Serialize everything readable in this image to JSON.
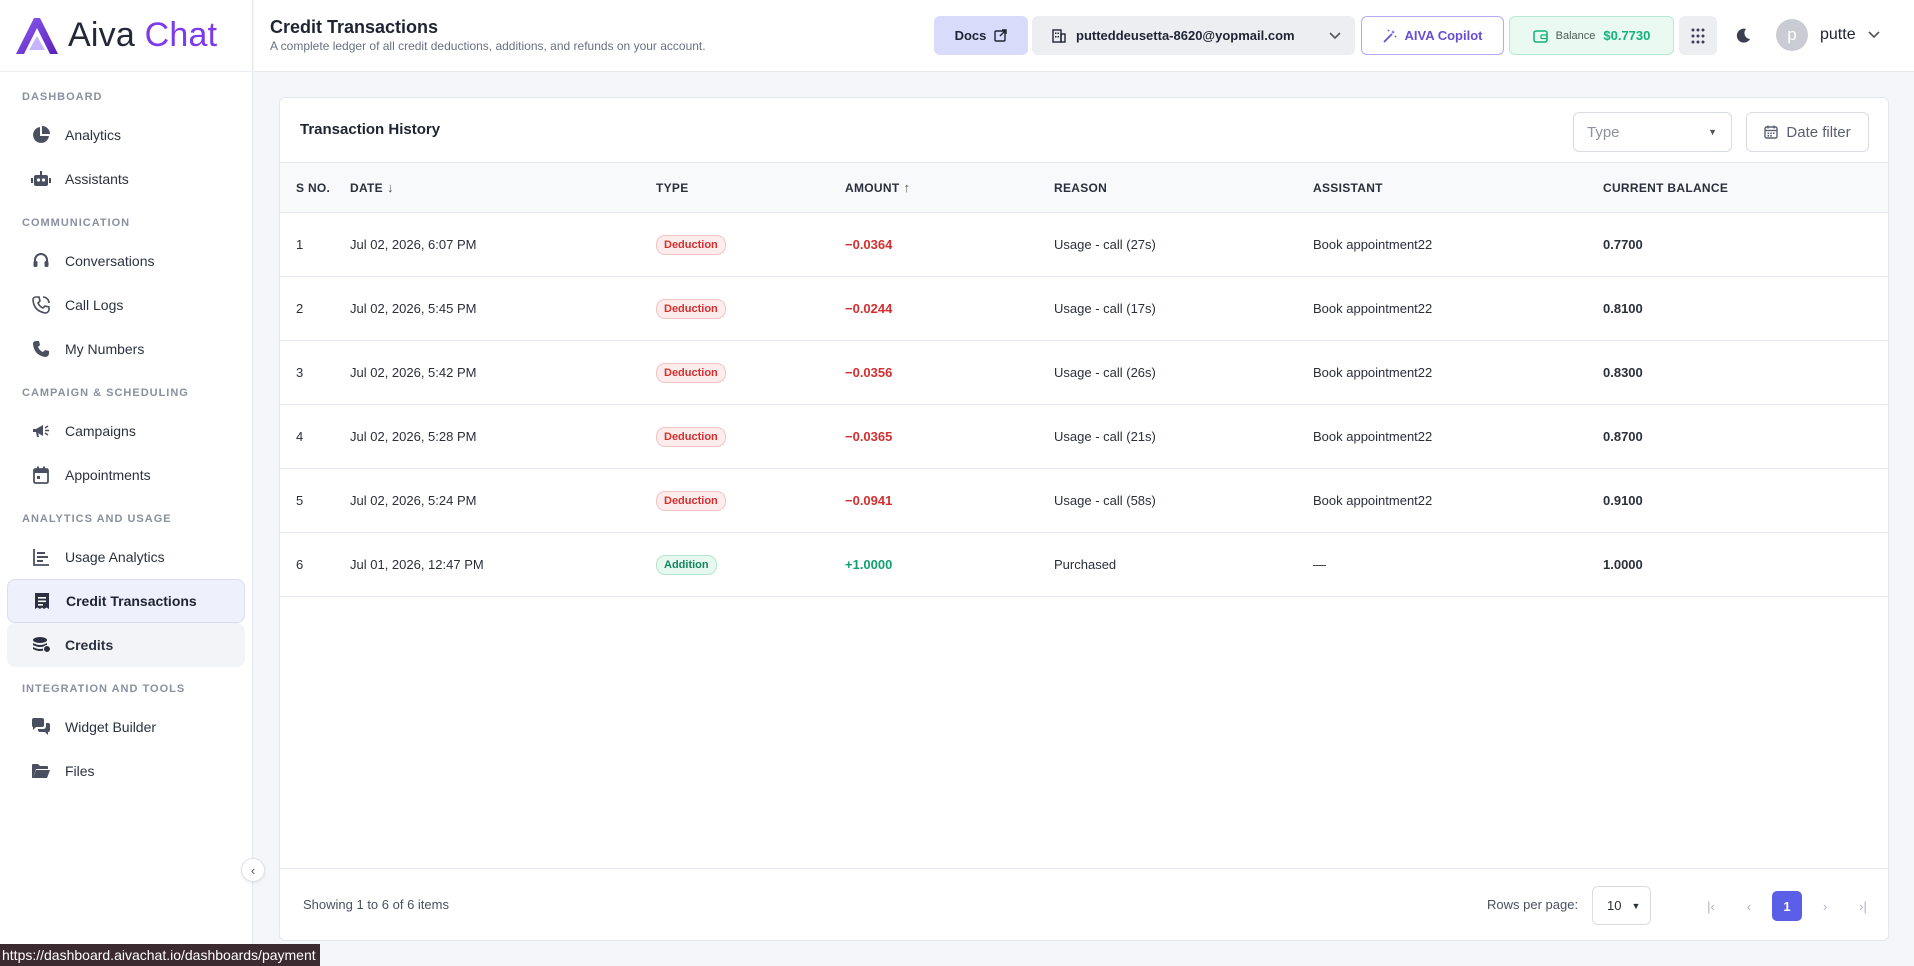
{
  "app": {
    "name_a": "Aiva",
    "name_b": " Chat",
    "brand_color": "#7c3aed"
  },
  "header": {
    "title": "Credit Transactions",
    "subtitle": "A complete ledger of all credit deductions, additions, and refunds on your account.",
    "docs_label": "Docs",
    "account_email": "putteddeusetta-8620@yopmail.com",
    "copilot_label": "AIVA Copilot",
    "balance_label": "Balance",
    "balance_value": "$0.7730",
    "user_initial": "p",
    "user_name": "putte"
  },
  "sidebar": {
    "sections": [
      {
        "title": "DASHBOARD",
        "items": [
          {
            "label": "Analytics",
            "icon": "pie-chart-icon"
          },
          {
            "label": "Assistants",
            "icon": "robot-icon"
          }
        ]
      },
      {
        "title": "COMMUNICATION",
        "items": [
          {
            "label": "Conversations",
            "icon": "headset-icon"
          },
          {
            "label": "Call Logs",
            "icon": "phone-log-icon"
          },
          {
            "label": "My Numbers",
            "icon": "phone-icon"
          }
        ]
      },
      {
        "title": "CAMPAIGN & SCHEDULING",
        "items": [
          {
            "label": "Campaigns",
            "icon": "megaphone-icon"
          },
          {
            "label": "Appointments",
            "icon": "calendar-icon"
          }
        ]
      },
      {
        "title": "ANALYTICS AND USAGE",
        "items": [
          {
            "label": "Usage Analytics",
            "icon": "bar-list-icon"
          },
          {
            "label": "Credit Transactions",
            "icon": "receipt-icon"
          },
          {
            "label": "Credits",
            "icon": "coins-icon"
          }
        ]
      },
      {
        "title": "INTEGRATION AND TOOLS",
        "items": [
          {
            "label": "Widget Builder",
            "icon": "chat-bubbles-icon"
          },
          {
            "label": "Files",
            "icon": "folder-icon"
          }
        ]
      }
    ]
  },
  "card": {
    "title": "Transaction History",
    "type_placeholder": "Type",
    "date_filter_label": "Date filter"
  },
  "table": {
    "columns": [
      "S NO.",
      "DATE",
      "TYPE",
      "AMOUNT",
      "REASON",
      "ASSISTANT",
      "CURRENT BALANCE"
    ],
    "rows": [
      {
        "sno": "1",
        "date": "Jul 02, 2026, 6:07 PM",
        "type": "Deduction",
        "amount": "−0.0364",
        "reason": "Usage - call (27s)",
        "assistant": "Book appointment22",
        "balance": "0.7700"
      },
      {
        "sno": "2",
        "date": "Jul 02, 2026, 5:45 PM",
        "type": "Deduction",
        "amount": "−0.0244",
        "reason": "Usage - call (17s)",
        "assistant": "Book appointment22",
        "balance": "0.8100"
      },
      {
        "sno": "3",
        "date": "Jul 02, 2026, 5:42 PM",
        "type": "Deduction",
        "amount": "−0.0356",
        "reason": "Usage - call (26s)",
        "assistant": "Book appointment22",
        "balance": "0.8300"
      },
      {
        "sno": "4",
        "date": "Jul 02, 2026, 5:28 PM",
        "type": "Deduction",
        "amount": "−0.0365",
        "reason": "Usage - call (21s)",
        "assistant": "Book appointment22",
        "balance": "0.8700"
      },
      {
        "sno": "5",
        "date": "Jul 02, 2026, 5:24 PM",
        "type": "Deduction",
        "amount": "−0.0941",
        "reason": "Usage - call (58s)",
        "assistant": "Book appointment22",
        "balance": "0.9100"
      },
      {
        "sno": "6",
        "date": "Jul 01, 2026, 12:47 PM",
        "type": "Addition",
        "amount": "+1.0000",
        "reason": "Purchased",
        "assistant": "—",
        "balance": "1.0000"
      }
    ]
  },
  "footer": {
    "showing": "Showing 1 to 6 of 6 items",
    "rows_per_page_label": "Rows per page:",
    "rows_per_page_value": "10",
    "current_page": "1"
  },
  "status_url": "https://dashboard.aivachat.io/dashboards/payment"
}
